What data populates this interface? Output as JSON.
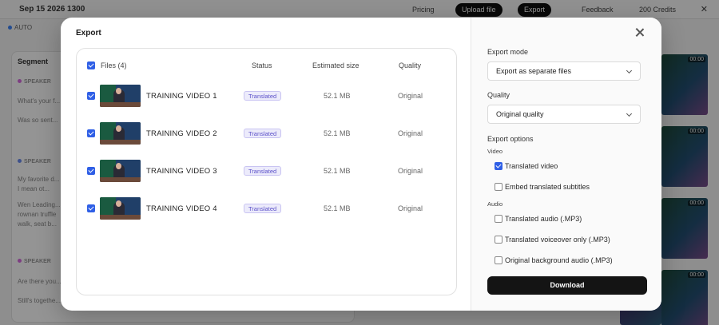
{
  "background": {
    "title": "Sep 15 2026 1300",
    "top_buttons": [
      "Pricing",
      "Upload file",
      "Export",
      "Feedback",
      "200 Credits"
    ],
    "subbar": "AUTO",
    "segment_title": "Segment",
    "speakers": [
      "SPEAKER",
      "SPEAKER",
      "SPEAKER"
    ],
    "lines": [
      "What's your f...",
      "Was so sent...",
      "My favorite d...",
      "I mean ot...",
      "Wen Leading...",
      "rownan truffle",
      "walk, seat b...",
      "Are there you...",
      "Still's togethe..."
    ],
    "thumb_timestamp": "00:00"
  },
  "modal": {
    "title": "Export",
    "files": {
      "header": {
        "files_label": "Files (4)",
        "status": "Status",
        "size": "Estimated size",
        "quality": "Quality"
      },
      "rows": [
        {
          "name": "TRAINING VIDEO 1",
          "status": "Translated",
          "size": "52.1 MB",
          "quality": "Original"
        },
        {
          "name": "TRAINING VIDEO 2",
          "status": "Translated",
          "size": "52.1 MB",
          "quality": "Original"
        },
        {
          "name": "TRAINING VIDEO 3",
          "status": "Translated",
          "size": "52.1 MB",
          "quality": "Original"
        },
        {
          "name": "TRAINING VIDEO 4",
          "status": "Translated",
          "size": "52.1 MB",
          "quality": "Original"
        }
      ]
    },
    "settings": {
      "export_mode_label": "Export mode",
      "export_mode_value": "Export as separate files",
      "quality_label": "Quality",
      "quality_value": "Original quality",
      "options_label": "Export options",
      "video_label": "Video",
      "video_options": [
        {
          "label": "Translated video",
          "checked": true
        },
        {
          "label": "Embed translated subtitles",
          "checked": false
        }
      ],
      "audio_label": "Audio",
      "audio_options": [
        {
          "label": "Translated audio (.MP3)",
          "checked": false
        },
        {
          "label": "Translated voiceover only (.MP3)",
          "checked": false
        },
        {
          "label": "Original background audio (.MP3)",
          "checked": false
        }
      ],
      "download_label": "Download"
    }
  },
  "colors": {
    "checkbox": "#2f5fe6",
    "badge_text": "#5a4fc8",
    "badge_bg": "#ecebfb",
    "download_bg": "#141414"
  }
}
